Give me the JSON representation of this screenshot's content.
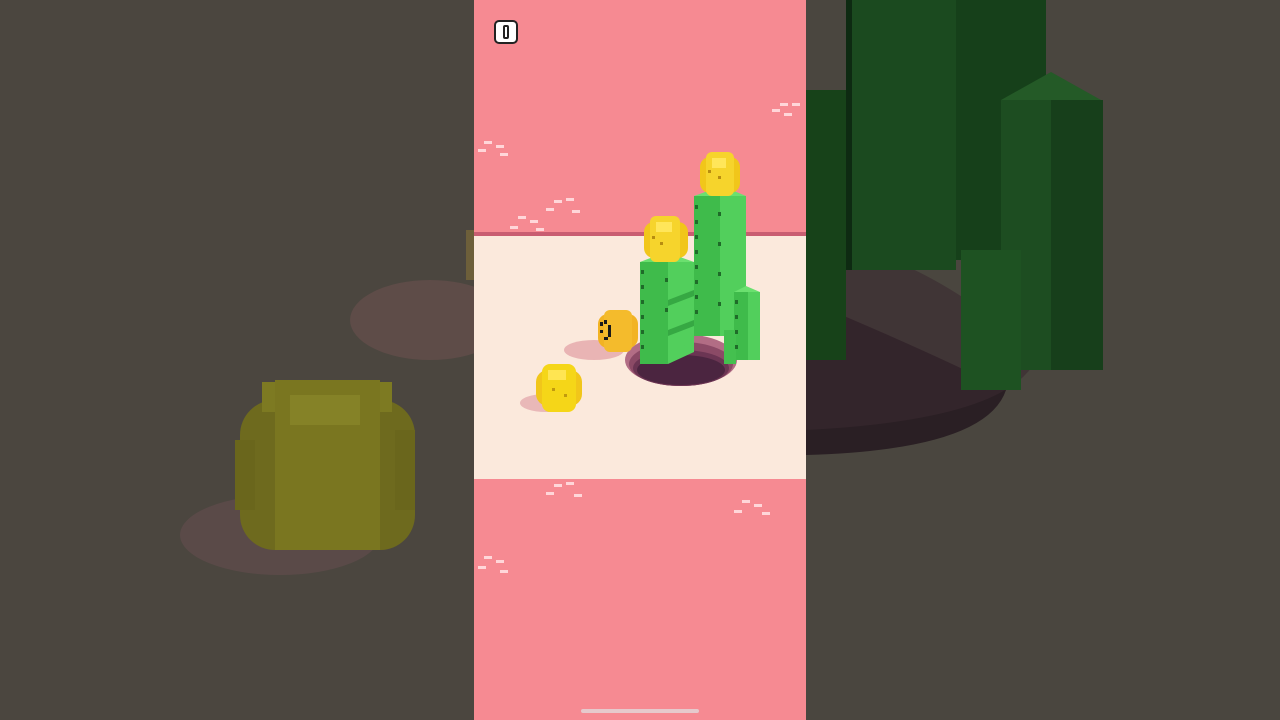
{
  "game": {
    "type": "voxel hole puzzle",
    "controls": {
      "pause_icon": "pause-icon"
    },
    "scene": {
      "background_color": "#f68a92",
      "floor_color": "#fbe9dc",
      "floor_edge_color": "#c95d71",
      "hole_color": "#5a2f48",
      "objects": [
        {
          "name": "cactus-tall",
          "color": "#4fcf5c",
          "has_flower": true
        },
        {
          "name": "cactus-medium",
          "color": "#4fcf5c",
          "has_flower": true
        },
        {
          "name": "cactus-small",
          "color": "#4fcf5c",
          "has_flower": false
        },
        {
          "name": "smiley-ball",
          "color": "#f2b323"
        },
        {
          "name": "yellow-ball",
          "color": "#f5d618"
        }
      ]
    }
  },
  "ui": {
    "home_indicator_color": "#e6c9cc"
  }
}
